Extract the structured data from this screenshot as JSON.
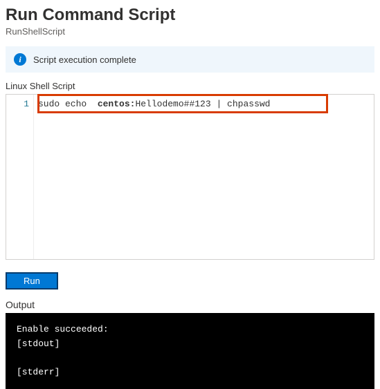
{
  "header": {
    "title": "Run Command Script",
    "subtitle": "RunShellScript"
  },
  "status": {
    "icon_label": "i",
    "message": "Script execution complete"
  },
  "editor": {
    "label": "Linux Shell Script",
    "line_number": "1",
    "code_prefix": "sudo echo  ",
    "code_user": "centos:",
    "code_rest": "Hellodemo##123 | chpasswd"
  },
  "actions": {
    "run_label": "Run"
  },
  "output": {
    "label": "Output",
    "content": "Enable succeeded: \n[stdout]\n\n[stderr]"
  }
}
